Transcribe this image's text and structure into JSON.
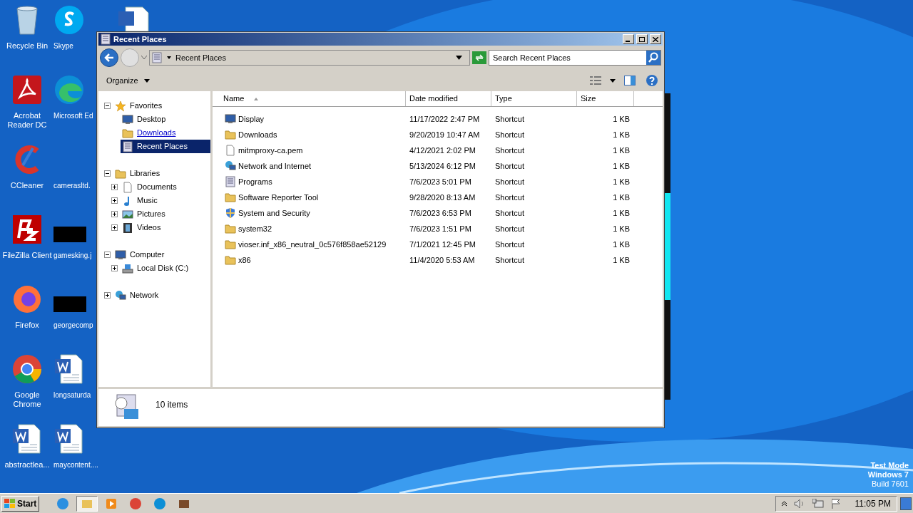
{
  "desktop_icons": [
    [
      {
        "label": "Recycle Bin",
        "kind": "bin"
      },
      {
        "label": "Acrobat Reader DC",
        "kind": "acrobat"
      },
      {
        "label": "CCleaner",
        "kind": "ccleaner"
      },
      {
        "label": "FileZilla Client",
        "kind": "filezilla"
      },
      {
        "label": "Firefox",
        "kind": "firefox"
      },
      {
        "label": "Google Chrome",
        "kind": "chrome"
      },
      {
        "label": "abstractlea...",
        "kind": "word"
      }
    ],
    [
      {
        "label": "Skype",
        "kind": "skype"
      },
      {
        "label": "Microsoft Ed",
        "kind": "edge"
      },
      {
        "label": "camerasltd.",
        "kind": "blank"
      },
      {
        "label": "gamesking.j",
        "kind": "redacted"
      },
      {
        "label": "georgecomp",
        "kind": "redacted"
      },
      {
        "label": "longsaturda",
        "kind": "word"
      },
      {
        "label": "maycontent....",
        "kind": "word"
      }
    ]
  ],
  "desktop_notice": [
    "Test Mode",
    "Windows 7",
    "Build 7601"
  ],
  "window": {
    "title": "Recent Places",
    "address": "Recent Places",
    "search": {
      "placeholder": "Search Recent Places"
    },
    "toolbar": {
      "organize": "Organize"
    },
    "nav_tree": [
      {
        "label": "Favorites",
        "kind": "star",
        "expanded": true,
        "selected": false,
        "hovered": false,
        "children": [
          {
            "label": "Desktop",
            "kind": "desktop",
            "selected": false,
            "hovered": false
          },
          {
            "label": "Downloads",
            "kind": "downloads",
            "selected": false,
            "hovered": true
          },
          {
            "label": "Recent Places",
            "kind": "recent",
            "selected": true,
            "hovered": false
          }
        ]
      },
      {
        "label": "Libraries",
        "kind": "libraries",
        "expanded": true,
        "selected": false,
        "hovered": false,
        "children": [
          {
            "label": "Documents",
            "kind": "documents",
            "expanded": false,
            "selected": false,
            "hovered": false
          },
          {
            "label": "Music",
            "kind": "music",
            "expanded": false,
            "selected": false,
            "hovered": false
          },
          {
            "label": "Pictures",
            "kind": "pictures",
            "expanded": false,
            "selected": false,
            "hovered": false
          },
          {
            "label": "Videos",
            "kind": "videos",
            "expanded": false,
            "selected": false,
            "hovered": false
          }
        ]
      },
      {
        "label": "Computer",
        "kind": "computer",
        "expanded": true,
        "selected": false,
        "hovered": false,
        "children": [
          {
            "label": "Local Disk (C:)",
            "kind": "disk",
            "expanded": false,
            "selected": false,
            "hovered": false
          }
        ]
      },
      {
        "label": "Network",
        "kind": "network",
        "expanded": false,
        "selected": false,
        "hovered": false
      }
    ],
    "columns": [
      {
        "label": "Name",
        "sorted": true
      },
      {
        "label": "Date modified",
        "sorted": false
      },
      {
        "label": "Type",
        "sorted": false
      },
      {
        "label": "Size",
        "sorted": false
      }
    ],
    "rows": [
      {
        "name": "Display",
        "date": "11/17/2022 2:47 PM",
        "type": "Shortcut",
        "size": "1 KB",
        "kind": "display"
      },
      {
        "name": "Downloads",
        "date": "9/20/2019 10:47 AM",
        "type": "Shortcut",
        "size": "1 KB",
        "kind": "folder"
      },
      {
        "name": "mitmproxy-ca.pem",
        "date": "4/12/2021 2:02 PM",
        "type": "Shortcut",
        "size": "1 KB",
        "kind": "file"
      },
      {
        "name": "Network and Internet",
        "date": "5/13/2024 6:12 PM",
        "type": "Shortcut",
        "size": "1 KB",
        "kind": "network"
      },
      {
        "name": "Programs",
        "date": "7/6/2023 5:01 PM",
        "type": "Shortcut",
        "size": "1 KB",
        "kind": "programs"
      },
      {
        "name": "Software Reporter Tool",
        "date": "9/28/2020 8:13 AM",
        "type": "Shortcut",
        "size": "1 KB",
        "kind": "folder"
      },
      {
        "name": "System and Security",
        "date": "7/6/2023 6:53 PM",
        "type": "Shortcut",
        "size": "1 KB",
        "kind": "security"
      },
      {
        "name": "system32",
        "date": "7/6/2023 1:51 PM",
        "type": "Shortcut",
        "size": "1 KB",
        "kind": "folder"
      },
      {
        "name": "vioser.inf_x86_neutral_0c576f858ae52129",
        "date": "7/1/2021 12:45 PM",
        "type": "Shortcut",
        "size": "1 KB",
        "kind": "folder"
      },
      {
        "name": "x86",
        "date": "11/4/2020 5:53 AM",
        "type": "Shortcut",
        "size": "1 KB",
        "kind": "folder"
      }
    ],
    "status": "10 items"
  },
  "taskbar": {
    "start": "Start",
    "apps": [
      {
        "kind": "ie",
        "selected": false
      },
      {
        "kind": "explorer",
        "selected": true
      },
      {
        "kind": "media",
        "selected": false
      },
      {
        "kind": "chrome",
        "selected": false
      },
      {
        "kind": "edge",
        "selected": false
      },
      {
        "kind": "package",
        "selected": false
      }
    ],
    "clock": "11:05 PM"
  }
}
